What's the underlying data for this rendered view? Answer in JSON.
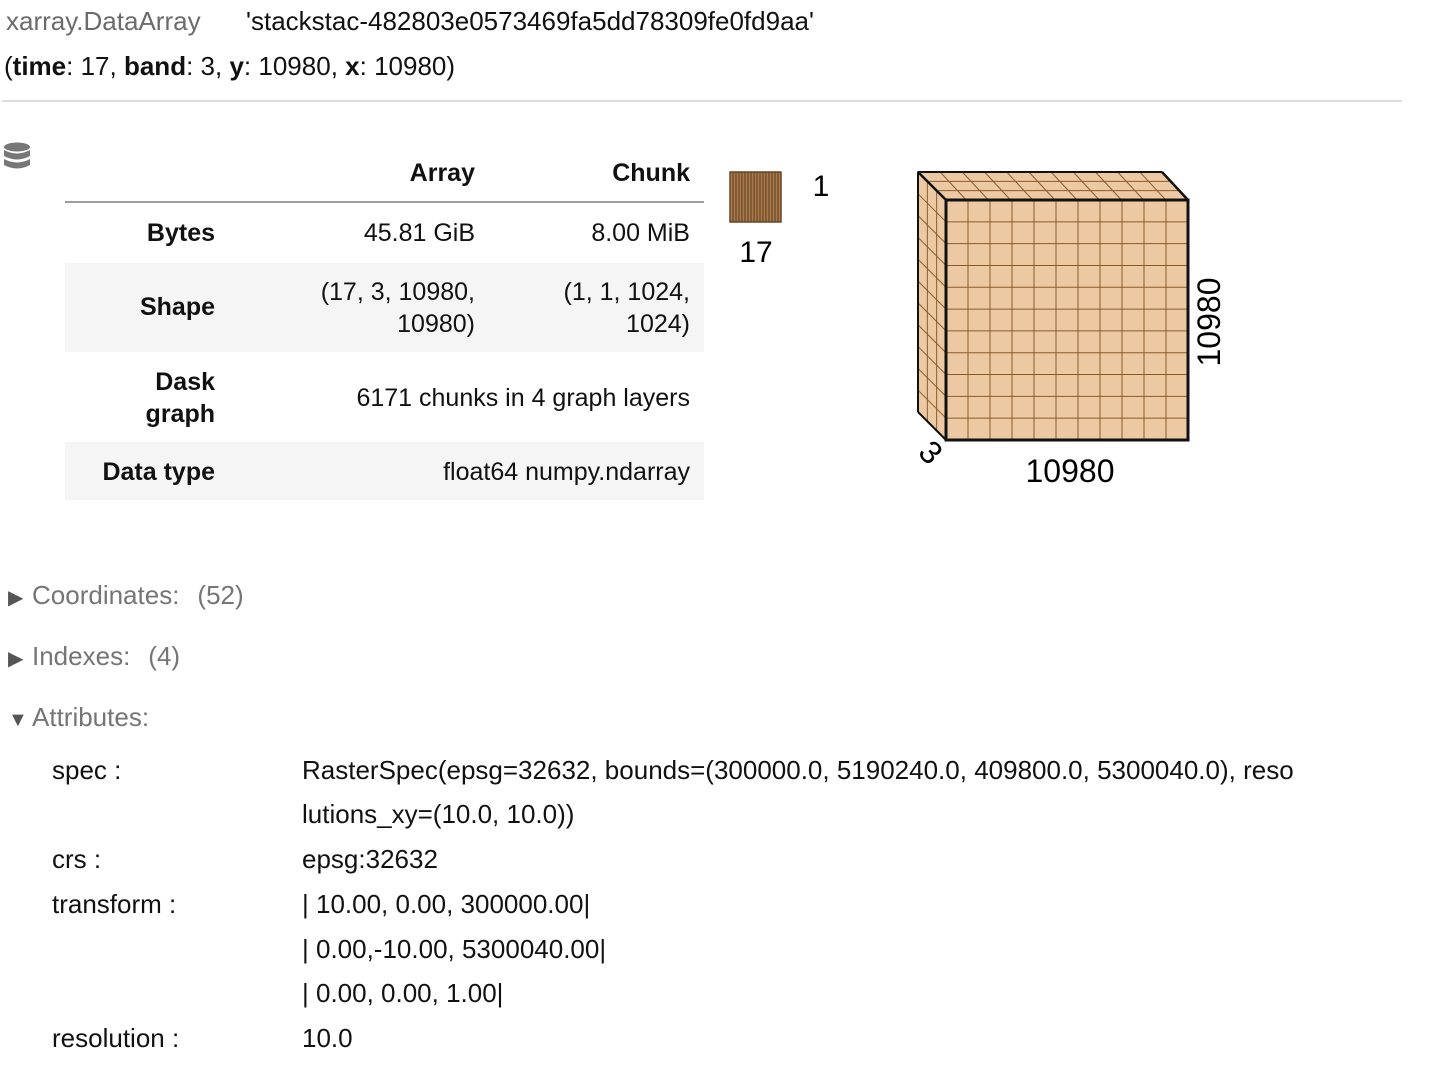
{
  "header": {
    "type_name": "xarray.DataArray",
    "array_name": "'stackstac-482803e0573469fa5dd78309fe0fd9aa'",
    "dims": [
      {
        "name": "time",
        "size": "17"
      },
      {
        "name": "band",
        "size": "3"
      },
      {
        "name": "y",
        "size": "10980"
      },
      {
        "name": "x",
        "size": "10980"
      }
    ]
  },
  "icons": {
    "data_repr": "database-icon",
    "collapsed": "triangle-right-icon",
    "expanded": "triangle-down-icon"
  },
  "colors": {
    "chunk_fill": "#ecc9a3",
    "chunk_fill_small": "#a97b4d",
    "grid": "#8b5a2b",
    "muted": "#757575"
  },
  "table": {
    "headers": {
      "array": "Array",
      "chunk": "Chunk"
    },
    "bytes": {
      "label": "Bytes",
      "array": "45.81 GiB",
      "chunk": "8.00 MiB"
    },
    "shape": {
      "label": "Shape",
      "array_l1": "(17, 3, 10980,",
      "array_l2": "10980)",
      "chunk_l1": "(1, 1, 1024,",
      "chunk_l2": "1024)"
    },
    "dask": {
      "label_l1": "Dask",
      "label_l2": "graph",
      "value": "6171 chunks in 4 graph layers"
    },
    "dtype": {
      "label": "Data type",
      "value": "float64 numpy.ndarray"
    }
  },
  "diagram": {
    "time_label": "17",
    "time_chunk_label": "1",
    "band_label": "3",
    "x_label": "10980",
    "y_label": "10980"
  },
  "sections": {
    "coords": {
      "label": "Coordinates:",
      "count": "(52)"
    },
    "indexes": {
      "label": "Indexes:",
      "count": "(4)"
    },
    "attrs": {
      "label": "Attributes:"
    }
  },
  "attributes": {
    "spec": {
      "key": "spec :",
      "val_l1": "RasterSpec(epsg=32632, bounds=(300000.0, 5190240.0, 409800.0, 5300040.0), reso",
      "val_l2": "lutions_xy=(10.0, 10.0))"
    },
    "crs": {
      "key": "crs :",
      "val": "epsg:32632"
    },
    "transform": {
      "key": "transform :",
      "val_l1": "| 10.00, 0.00, 300000.00|",
      "val_l2": "| 0.00,-10.00, 5300040.00|",
      "val_l3": "| 0.00, 0.00, 1.00|"
    },
    "resolution": {
      "key": "resolution :",
      "val": "10.0"
    }
  }
}
